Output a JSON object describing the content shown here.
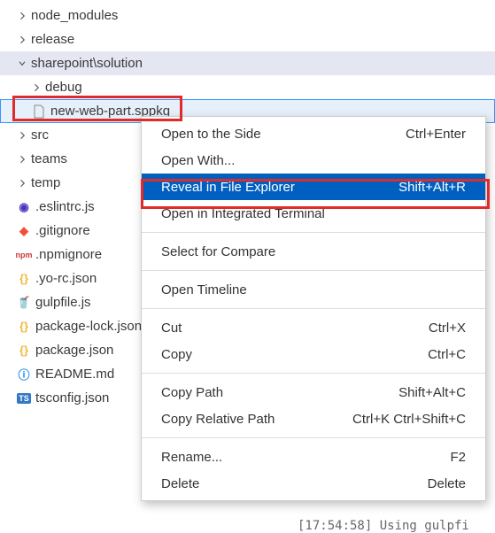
{
  "tree": {
    "items": [
      {
        "label": "node_modules",
        "depth": 0,
        "type": "folder",
        "open": false,
        "icon": "chevron-right"
      },
      {
        "label": "release",
        "depth": 0,
        "type": "folder",
        "open": false,
        "icon": "chevron-right"
      },
      {
        "label": "sharepoint\\solution",
        "depth": 0,
        "type": "folder",
        "open": true,
        "icon": "chevron-down",
        "expandedBg": true
      },
      {
        "label": "debug",
        "depth": 1,
        "type": "folder",
        "open": false,
        "icon": "chevron-right"
      },
      {
        "label": "new-web-part.sppkg",
        "depth": 1,
        "type": "file",
        "icon": "file-icon",
        "selected": true
      },
      {
        "label": "src",
        "depth": 0,
        "type": "folder",
        "open": false,
        "icon": "chevron-right"
      },
      {
        "label": "teams",
        "depth": 0,
        "type": "folder",
        "open": false,
        "icon": "chevron-right"
      },
      {
        "label": "temp",
        "depth": 0,
        "type": "folder",
        "open": false,
        "icon": "chevron-right"
      },
      {
        "label": ".eslintrc.js",
        "depth": 0,
        "type": "file",
        "icon": "eslint-icon",
        "color": "#4b32c3"
      },
      {
        "label": ".gitignore",
        "depth": 0,
        "type": "file",
        "icon": "git-icon",
        "color": "#f05033"
      },
      {
        "label": ".npmignore",
        "depth": 0,
        "type": "file",
        "icon": "npm-icon",
        "color": "#cb3837"
      },
      {
        "label": ".yo-rc.json",
        "depth": 0,
        "type": "file",
        "icon": "json-icon",
        "color": "#f0b93a"
      },
      {
        "label": "gulpfile.js",
        "depth": 0,
        "type": "file",
        "icon": "gulp-icon",
        "color": "#cf4647"
      },
      {
        "label": "package-lock.json",
        "depth": 0,
        "type": "file",
        "icon": "json-icon",
        "color": "#f0b93a"
      },
      {
        "label": "package.json",
        "depth": 0,
        "type": "file",
        "icon": "json-icon",
        "color": "#f0b93a"
      },
      {
        "label": "README.md",
        "depth": 0,
        "type": "file",
        "icon": "info-icon",
        "color": "#1e88e5"
      },
      {
        "label": "tsconfig.json",
        "depth": 0,
        "type": "file",
        "icon": "ts-icon",
        "color": "#3178c6"
      }
    ]
  },
  "context_menu": {
    "groups": [
      [
        {
          "label": "Open to the Side",
          "shortcut": "Ctrl+Enter"
        },
        {
          "label": "Open With..."
        },
        {
          "label": "Reveal in File Explorer",
          "shortcut": "Shift+Alt+R",
          "highlighted": true
        },
        {
          "label": "Open in Integrated Terminal"
        }
      ],
      [
        {
          "label": "Select for Compare"
        }
      ],
      [
        {
          "label": "Open Timeline"
        }
      ],
      [
        {
          "label": "Cut",
          "shortcut": "Ctrl+X"
        },
        {
          "label": "Copy",
          "shortcut": "Ctrl+C"
        }
      ],
      [
        {
          "label": "Copy Path",
          "shortcut": "Shift+Alt+C"
        },
        {
          "label": "Copy Relative Path",
          "shortcut": "Ctrl+K Ctrl+Shift+C"
        }
      ],
      [
        {
          "label": "Rename...",
          "shortcut": "F2"
        },
        {
          "label": "Delete",
          "shortcut": "Delete"
        }
      ]
    ]
  },
  "terminal_snippet": "[17:54:58] Using gulpfi"
}
